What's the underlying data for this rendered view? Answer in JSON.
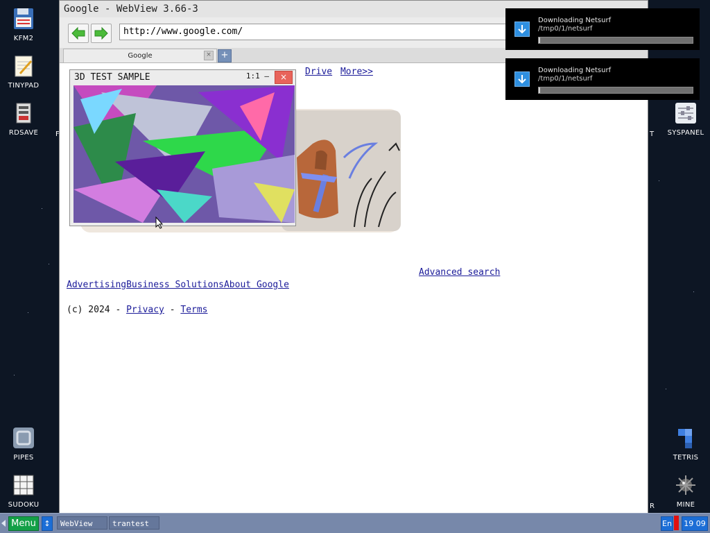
{
  "desktop": {
    "left_icons": [
      {
        "label": "KFM2",
        "icon": "floppy-disk-icon"
      },
      {
        "label": "TINYPAD",
        "icon": "notepad-icon"
      },
      {
        "label": "RDSAVE",
        "icon": "ram-save-icon"
      },
      {
        "label": "PIPES",
        "icon": "pipes-icon"
      },
      {
        "label": "SUDOKU",
        "icon": "sudoku-icon"
      }
    ],
    "right_icons": [
      {
        "label": "SYSPANEL",
        "icon": "sliders-icon"
      },
      {
        "label": "TETRIS",
        "icon": "tetris-icon"
      },
      {
        "label": "MINE",
        "icon": "mine-icon"
      }
    ],
    "partial_labels": {
      "left_f": "F",
      "right_t": "T",
      "right_r": "R"
    }
  },
  "browser": {
    "title": "Google - WebView 3.66-3",
    "url": "http://www.google.com/",
    "tab_label": "Google",
    "tab_close": "×",
    "tab_add": "+",
    "page": {
      "nav_links": [
        "Drive",
        "More>>"
      ],
      "advanced_search": "Advanced search",
      "footer_links": [
        "Advertising",
        "Business Solutions",
        "About Google"
      ],
      "copyright": "(c) 2024 - ",
      "sep": " - ",
      "privacy": "Privacy",
      "terms": "Terms"
    }
  },
  "notifications": [
    {
      "title": "Downloading Netsurf",
      "path": "/tmp0/1/netsurf",
      "progress": 0.01
    },
    {
      "title": "Downloading Netsurf",
      "path": "/tmp0/1/netsurf",
      "progress": 0.01
    }
  ],
  "test3d": {
    "title": "3D TEST SAMPLE",
    "close": "×",
    "indicator": "1:1 —"
  },
  "taskbar": {
    "menu": "Menu",
    "tasks": [
      "WebView",
      "trantest"
    ],
    "lang": "En",
    "time": "19 09"
  },
  "colors": {
    "taskbar": "#7788aa",
    "menu": "#13a047",
    "tray": "#1c6ed6",
    "close": "#e8645b"
  }
}
